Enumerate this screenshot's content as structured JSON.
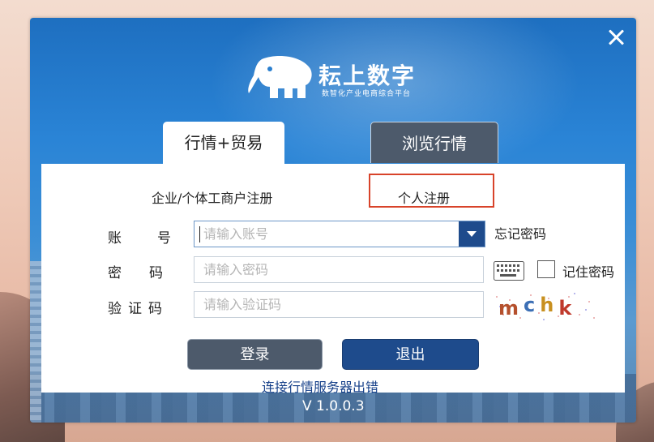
{
  "app": {
    "brand_name": "耘上数字",
    "brand_subtitle": "数智化产业电商综合平台",
    "version": "V 1.0.0.3"
  },
  "tabs": [
    {
      "label": "行情+贸易",
      "active": true
    },
    {
      "label": "浏览行情",
      "active": false
    }
  ],
  "registration": {
    "company_label": "企业/个体工商户注册",
    "personal_label": "个人注册",
    "highlight_color": "#d8432a"
  },
  "form": {
    "account_label_a": "账",
    "account_label_b": "号",
    "account_placeholder": "请输入账号",
    "password_label_a": "密",
    "password_label_b": "码",
    "password_placeholder": "请输入密码",
    "code_label": "验证码",
    "code_placeholder": "请输入验证码",
    "forgot_label": "忘记密码",
    "remember_label": "记住密码",
    "remember_checked": false,
    "captcha_text": "mchk"
  },
  "buttons": {
    "login": "登录",
    "exit": "退出"
  },
  "status_text": "连接行情服务器出错",
  "colors": {
    "primary_dark": "#1e4b8c",
    "button_gray": "#4d5a6b",
    "status_text": "#17418a"
  },
  "icons": {
    "close": "close-icon",
    "dropdown": "chevron-down-icon",
    "keyboard": "keyboard-icon",
    "logo": "elephant-logo-icon"
  }
}
